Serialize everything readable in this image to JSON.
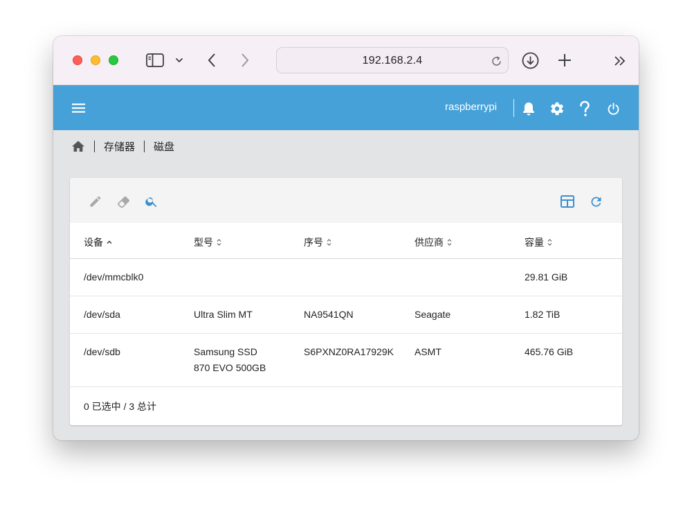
{
  "browser": {
    "address": "192.168.2.4",
    "icons": [
      "sidebar-icon",
      "chevron-down-icon",
      "back-icon",
      "forward-icon",
      "reload-icon",
      "download-icon",
      "new-tab-icon",
      "overflow-icon"
    ]
  },
  "appbar": {
    "hostname": "raspberrypi",
    "icons": [
      "menu-icon",
      "bell-icon",
      "gear-icon",
      "help-icon",
      "power-icon"
    ],
    "color": "#45a1d8"
  },
  "breadcrumb": {
    "items": [
      "存储器",
      "磁盘"
    ]
  },
  "toolbar": {
    "icons": [
      "edit-icon",
      "eraser-icon",
      "search-icon",
      "columns-icon",
      "refresh-icon"
    ],
    "accent": "#3a8fd0"
  },
  "table": {
    "headers": [
      "设备",
      "型号",
      "序号",
      "供应商",
      "容量"
    ],
    "rows": [
      {
        "device": "/dev/mmcblk0",
        "model_line1": "",
        "model_line2": "",
        "serial": "",
        "vendor": "",
        "capacity": "29.81 GiB"
      },
      {
        "device": "/dev/sda",
        "model_line1": "Ultra Slim MT",
        "model_line2": "",
        "serial": "NA9541QN",
        "vendor": "Seagate",
        "capacity": "1.82 TiB"
      },
      {
        "device": "/dev/sdb",
        "model_line1": "Samsung SSD",
        "model_line2": "870 EVO 500GB",
        "serial": "S6PXNZ0RA17929K",
        "vendor": "ASMT",
        "capacity": "465.76 GiB"
      }
    ],
    "footer": "0 已选中 / 3 总计"
  }
}
